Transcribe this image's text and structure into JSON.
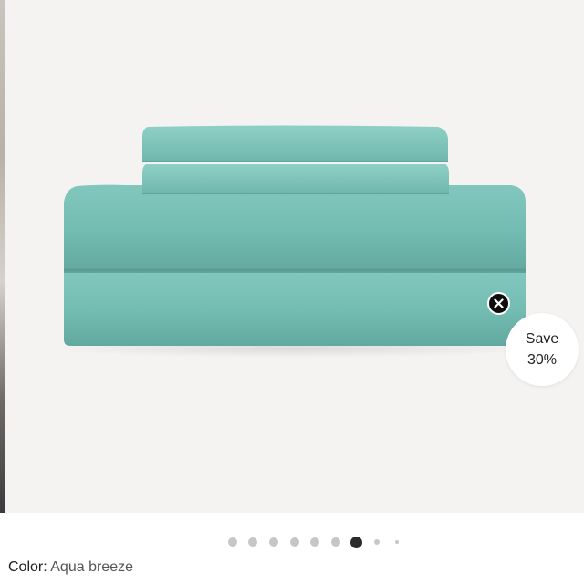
{
  "product": {
    "image_alt": "Folded aqua sheet set",
    "color_label": "Color:",
    "color_value": "Aqua breeze",
    "swatch_color": "#7bbfb5"
  },
  "badge": {
    "line1": "Save",
    "line2": "30%"
  },
  "carousel": {
    "total_dots": 9,
    "active_index": 6
  },
  "icons": {
    "close": "close-icon"
  }
}
